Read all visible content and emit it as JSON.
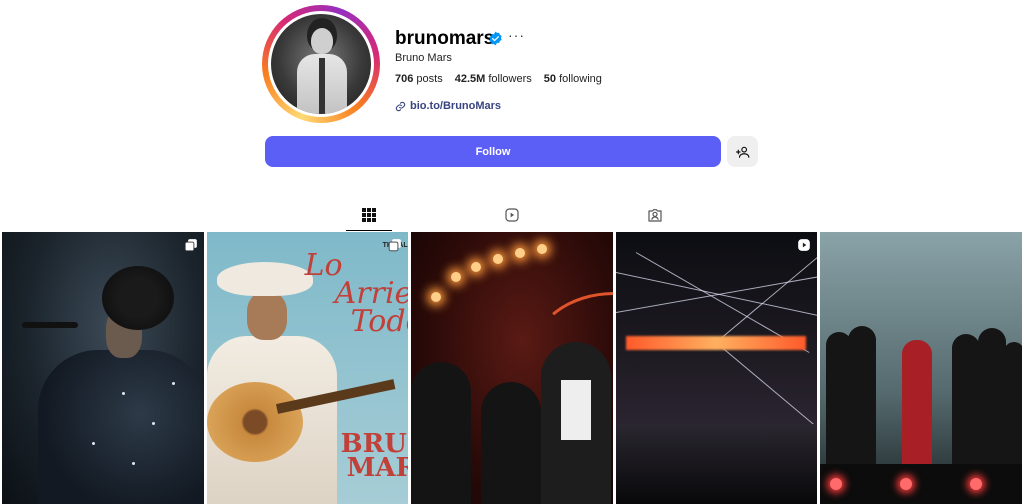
{
  "profile": {
    "username": "brunomars",
    "verified": true,
    "full_name": "Bruno Mars",
    "more_label": "···",
    "stats": [
      {
        "value": "706",
        "label": "posts"
      },
      {
        "value": "42.5M",
        "label": "followers"
      },
      {
        "value": "50",
        "label": "following"
      }
    ],
    "link_text": "bio.to/BrunoMars"
  },
  "actions": {
    "follow_label": "Follow"
  },
  "tabs": [
    {
      "icon": "grid-icon",
      "active": true
    },
    {
      "icon": "reels-icon",
      "active": false
    },
    {
      "icon": "tagged-icon",
      "active": false
    }
  ],
  "posts": [
    {
      "badge": "carousel-icon"
    },
    {
      "badge": "carousel-icon",
      "text_lines": [
        "Lo",
        "Arries",
        "Todo"
      ],
      "text_lower": [
        "BRUN",
        "MAR"
      ],
      "corner_label": "THE AL"
    },
    {
      "badge": null
    },
    {
      "badge": "reel-icon"
    },
    {
      "badge": null
    }
  ],
  "colors": {
    "follow_button": "#5b5ff6",
    "verified_badge": "#0095f6",
    "link": "#384480",
    "poster_red": "#c2403a"
  }
}
